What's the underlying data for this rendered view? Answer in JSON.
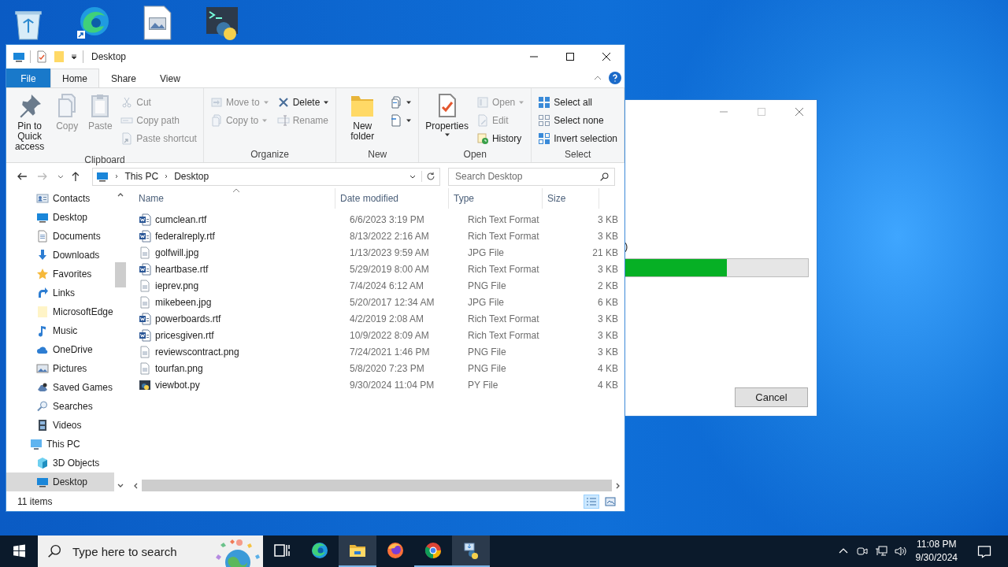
{
  "explorer": {
    "title": "Desktop",
    "ribbon_tabs": [
      {
        "label": "File",
        "kind": "file",
        "selected": false
      },
      {
        "label": "Home",
        "kind": "tab",
        "selected": true
      },
      {
        "label": "Share",
        "kind": "tab",
        "selected": false
      },
      {
        "label": "View",
        "kind": "tab",
        "selected": false
      }
    ],
    "ribbon_groups": [
      {
        "name": "Clipboard",
        "columns": [
          [
            {
              "label": "Pin to Quick access",
              "kind": "pin",
              "disabled": false,
              "dropdown": false
            }
          ],
          [
            {
              "label": "Copy",
              "kind": "copy",
              "disabled": true,
              "dropdown": false
            }
          ],
          [
            {
              "label": "Paste",
              "kind": "paste",
              "disabled": true,
              "dropdown": false
            }
          ],
          [
            {
              "label": "Cut",
              "kind": "cut",
              "disabled": true,
              "dropdown": false
            },
            {
              "label": "Copy path",
              "kind": "copypath",
              "disabled": true,
              "dropdown": false
            },
            {
              "label": "Paste shortcut",
              "kind": "shortcut",
              "disabled": true,
              "dropdown": false
            }
          ]
        ]
      },
      {
        "name": "Organize",
        "columns": [
          [
            {
              "label": "Move to",
              "kind": "moveto",
              "disabled": true,
              "dropdown": true
            },
            {
              "label": "Copy to",
              "kind": "copyto",
              "disabled": true,
              "dropdown": true
            }
          ],
          [
            {
              "label": "Delete",
              "kind": "delete",
              "disabled": false,
              "dropdown": true
            },
            {
              "label": "Rename",
              "kind": "rename",
              "disabled": true,
              "dropdown": false
            }
          ]
        ]
      },
      {
        "name": "New",
        "columns": [
          [
            {
              "label": "New folder",
              "kind": "newfolder",
              "disabled": false,
              "dropdown": false
            }
          ],
          [
            {
              "kind": "newitem",
              "disabled": false,
              "dropdown": true
            },
            {
              "kind": "easyaccess",
              "disabled": false,
              "dropdown": true
            }
          ]
        ]
      },
      {
        "name": "Open",
        "columns": [
          [
            {
              "label": "Properties",
              "kind": "properties",
              "disabled": false,
              "dropdown": true
            }
          ],
          [
            {
              "label": "Open",
              "kind": "open",
              "disabled": true,
              "dropdown": true
            },
            {
              "label": "Edit",
              "kind": "edit",
              "disabled": true,
              "dropdown": false
            },
            {
              "label": "History",
              "kind": "history",
              "disabled": false,
              "dropdown": false
            }
          ]
        ]
      },
      {
        "name": "Select",
        "columns": [
          [
            {
              "label": "Select all",
              "kind": "selectall",
              "disabled": false,
              "dropdown": false
            },
            {
              "label": "Select none",
              "kind": "selectnone",
              "disabled": false,
              "dropdown": false
            },
            {
              "label": "Invert selection",
              "kind": "invert",
              "disabled": false,
              "dropdown": false
            }
          ]
        ]
      }
    ],
    "breadcrumbs": [
      "This PC",
      "Desktop"
    ],
    "search": {
      "placeholder": "Search Desktop"
    },
    "nav_tree": [
      {
        "label": "Contacts",
        "kind": "contacts",
        "selected": false
      },
      {
        "label": "Desktop",
        "kind": "desktop",
        "selected": false
      },
      {
        "label": "Documents",
        "kind": "documents",
        "selected": false
      },
      {
        "label": "Downloads",
        "kind": "downloads",
        "selected": false
      },
      {
        "label": "Favorites",
        "kind": "favorites",
        "selected": false
      },
      {
        "label": "Links",
        "kind": "links",
        "selected": false
      },
      {
        "label": "MicrosoftEdge",
        "kind": "folder",
        "selected": false
      },
      {
        "label": "Music",
        "kind": "music",
        "selected": false
      },
      {
        "label": "OneDrive",
        "kind": "onedrive",
        "selected": false
      },
      {
        "label": "Pictures",
        "kind": "pictures",
        "selected": false
      },
      {
        "label": "Saved Games",
        "kind": "games",
        "selected": false
      },
      {
        "label": "Searches",
        "kind": "searches",
        "selected": false
      },
      {
        "label": "Videos",
        "kind": "videos",
        "selected": false
      },
      {
        "label": "This PC",
        "kind": "pc",
        "selected": false,
        "children": [
          {
            "label": "3D Objects",
            "kind": "cube",
            "selected": false
          },
          {
            "label": "Desktop",
            "kind": "desktop",
            "selected": true
          }
        ]
      }
    ],
    "columns": [
      {
        "label": "Name",
        "sorted": true
      },
      {
        "label": "Date modified",
        "sorted": false
      },
      {
        "label": "Type",
        "sorted": false
      },
      {
        "label": "Size",
        "sorted": false
      }
    ],
    "files": [
      {
        "name": "cumclean.rtf",
        "date": "6/6/2023 3:19 PM",
        "type": "Rich Text Format",
        "size": "3 KB",
        "kind": "rtf"
      },
      {
        "name": "federalreply.rtf",
        "date": "8/13/2022 2:16 AM",
        "type": "Rich Text Format",
        "size": "3 KB",
        "kind": "rtf"
      },
      {
        "name": "golfwill.jpg",
        "date": "1/13/2023 9:59 AM",
        "type": "JPG File",
        "size": "21 KB",
        "kind": "image"
      },
      {
        "name": "heartbase.rtf",
        "date": "5/29/2019 8:00 AM",
        "type": "Rich Text Format",
        "size": "3 KB",
        "kind": "rtf"
      },
      {
        "name": "ieprev.png",
        "date": "7/4/2024 6:12 AM",
        "type": "PNG File",
        "size": "2 KB",
        "kind": "image"
      },
      {
        "name": "mikebeen.jpg",
        "date": "5/20/2017 12:34 AM",
        "type": "JPG File",
        "size": "6 KB",
        "kind": "image"
      },
      {
        "name": "powerboards.rtf",
        "date": "4/2/2019 2:08 AM",
        "type": "Rich Text Format",
        "size": "3 KB",
        "kind": "rtf"
      },
      {
        "name": "pricesgiven.rtf",
        "date": "10/9/2022 8:09 AM",
        "type": "Rich Text Format",
        "size": "3 KB",
        "kind": "rtf"
      },
      {
        "name": "reviewscontract.png",
        "date": "7/24/2021 1:46 PM",
        "type": "PNG File",
        "size": "3 KB",
        "kind": "image"
      },
      {
        "name": "tourfan.png",
        "date": "5/8/2020 7:23 PM",
        "type": "PNG File",
        "size": "4 KB",
        "kind": "image"
      },
      {
        "name": "viewbot.py",
        "date": "9/30/2024 11:04 PM",
        "type": "PY File",
        "size": "4 KB",
        "kind": "python"
      }
    ],
    "status": "11 items",
    "views": [
      {
        "kind": "details",
        "selected": true
      },
      {
        "kind": "tiles",
        "selected": false
      }
    ]
  },
  "progress_dialog": {
    "text": ")",
    "level": 0.56,
    "button": "Cancel"
  },
  "taskbar": {
    "search_placeholder": "Type here to search",
    "apps": [
      {
        "kind": "taskview",
        "running": false,
        "active": false
      },
      {
        "kind": "edge",
        "running": false,
        "active": false
      },
      {
        "kind": "explorer",
        "running": true,
        "active": true
      },
      {
        "kind": "firefox",
        "running": false,
        "active": false
      },
      {
        "kind": "chrome",
        "running": true,
        "active": false
      },
      {
        "kind": "installer",
        "running": true,
        "active": true
      }
    ],
    "time": "11:08 PM",
    "date": "9/30/2024"
  }
}
